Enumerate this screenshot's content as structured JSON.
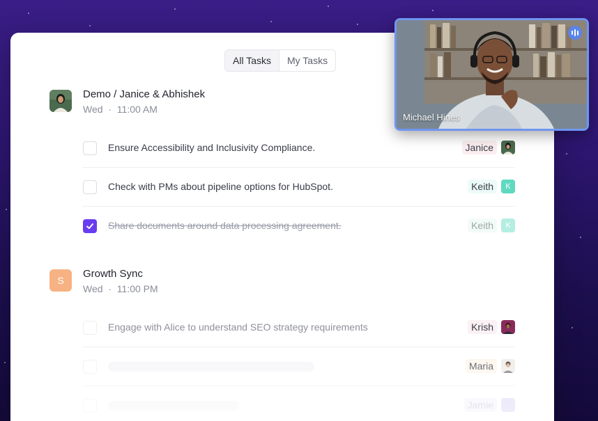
{
  "tabs": [
    {
      "label": "All Tasks",
      "active": true
    },
    {
      "label": "My Tasks",
      "active": false
    }
  ],
  "meetings": [
    {
      "title": "Demo / Janice & Abhishek",
      "day": "Wed",
      "separator": "·",
      "time": "11:00 AM",
      "avatar": "photo",
      "tasks": [
        {
          "text": "Ensure Accessibility and Inclusivity Compliance.",
          "done": false,
          "assignee": "Janice"
        },
        {
          "text": "Check with PMs about pipeline options for HubSpot.",
          "done": false,
          "assignee": "Keith",
          "initial": "K"
        },
        {
          "text": "Share documents around data processing agreement.",
          "done": true,
          "assignee": "Keith",
          "initial": "K"
        }
      ]
    },
    {
      "title": "Growth Sync",
      "day": "Wed",
      "separator": "·",
      "time": "11:00 PM",
      "avatar_letter": "S",
      "avatar_color": "#f6b283",
      "tasks": [
        {
          "text": "Engage with Alice to understand SEO strategy requirements",
          "done": false,
          "assignee": "Krish"
        },
        {
          "text": "",
          "done": false,
          "assignee": "Maria"
        },
        {
          "text": "",
          "done": false,
          "assignee": "Jamie"
        }
      ]
    }
  ],
  "video": {
    "participant_name": "Michael Hines",
    "status_icon": "audio-bars-icon",
    "border_color": "#6f95f2"
  },
  "colors": {
    "accent": "#6a3cf0",
    "keith_chip": "#5fd9c0",
    "background_top": "#3a1d86"
  }
}
